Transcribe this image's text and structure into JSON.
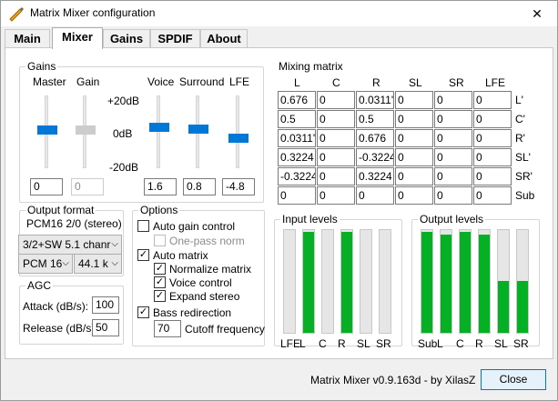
{
  "window": {
    "title": "Matrix Mixer configuration",
    "close_glyph": "✕"
  },
  "tabs": [
    "Main",
    "Mixer",
    "Gains",
    "SPDIF",
    "About"
  ],
  "gains": {
    "group_title": "Gains",
    "labels": [
      "Master",
      "Gain",
      "Voice",
      "Surround",
      "LFE"
    ],
    "scale": [
      "+20dB",
      "0dB",
      "-20dB"
    ],
    "values": [
      "0",
      "0",
      "1.6",
      "0.8",
      "-4.8"
    ]
  },
  "output_format": {
    "group_title": "Output format",
    "format_text": "PCM16 2/0 (stereo)",
    "layout_select": "3/2+SW 5.1 chanr",
    "sample_select": "PCM 16",
    "rate_select": "44.1 k"
  },
  "agc": {
    "group_title": "AGC",
    "attack_label": "Attack (dB/s):",
    "attack_value": "100",
    "release_label": "Release (dB/s):",
    "release_value": "50"
  },
  "options": {
    "group_title": "Options",
    "auto_gain": "Auto gain control",
    "one_pass": "One-pass norm",
    "auto_matrix": "Auto matrix",
    "normalize": "Normalize matrix",
    "voice_control": "Voice control",
    "expand_stereo": "Expand stereo",
    "bass_redirection": "Bass redirection",
    "cutoff_value": "70",
    "cutoff_label": "Cutoff frequency"
  },
  "matrix": {
    "group_title": "Mixing matrix",
    "columns": [
      "L",
      "C",
      "R",
      "SL",
      "SR",
      "LFE"
    ],
    "row_labels": [
      "L'",
      "C'",
      "R'",
      "SL'",
      "SR'",
      "Sub"
    ],
    "rows": [
      [
        "0.676",
        "0",
        "0.0311'",
        "0",
        "0",
        "0"
      ],
      [
        "0.5",
        "0",
        "0.5",
        "0",
        "0",
        "0"
      ],
      [
        "0.0311'",
        "0",
        "0.676",
        "0",
        "0",
        "0"
      ],
      [
        "0.3224",
        "0",
        "-0.3224",
        "0",
        "0",
        "0"
      ],
      [
        "-0.3224",
        "0",
        "0.3224",
        "0",
        "0",
        "0"
      ],
      [
        "0",
        "0",
        "0",
        "0",
        "0",
        "0"
      ]
    ]
  },
  "input_levels": {
    "group_title": "Input levels",
    "labels": [
      "LFE",
      "L",
      "C",
      "R",
      "SL",
      "SR"
    ],
    "levels": [
      0,
      0.98,
      0,
      0.98,
      0,
      0
    ]
  },
  "output_levels": {
    "group_title": "Output levels",
    "labels": [
      "Sub",
      "L",
      "C",
      "R",
      "SL",
      "SR"
    ],
    "levels": [
      0.98,
      0.96,
      0.98,
      0.96,
      0.5,
      0.5
    ]
  },
  "footer": {
    "status": "Matrix Mixer v0.9.163d - by XilasZ",
    "close_label": "Close"
  },
  "colors": {
    "accent": "#0078d7",
    "meter_fill": "#06b025"
  }
}
